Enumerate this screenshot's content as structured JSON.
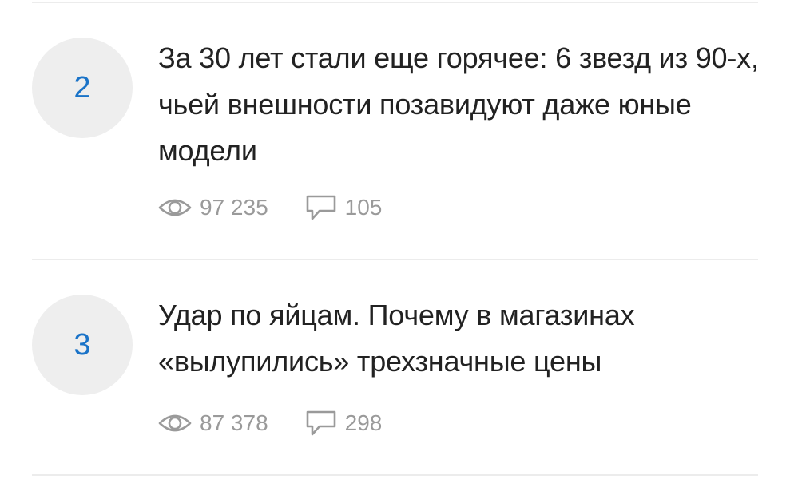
{
  "articles": [
    {
      "rank": "2",
      "title": "За 30 лет стали еще горячее: 6 звезд из 90-х, чьей внешности позавидуют даже юные модели",
      "views": "97 235",
      "comments": "105"
    },
    {
      "rank": "3",
      "title": "Удар по яйцам. Почему в магазинах «вылупились» трехзначные цены",
      "views": "87 378",
      "comments": "298"
    }
  ],
  "icons": {
    "views": "eye-icon",
    "comments": "comment-icon"
  },
  "colors": {
    "rank_number": "#1a73c8",
    "rank_circle": "#eeeeee",
    "title_text": "#222222",
    "meta_text": "#9a9a9a",
    "divider": "#ececec"
  }
}
